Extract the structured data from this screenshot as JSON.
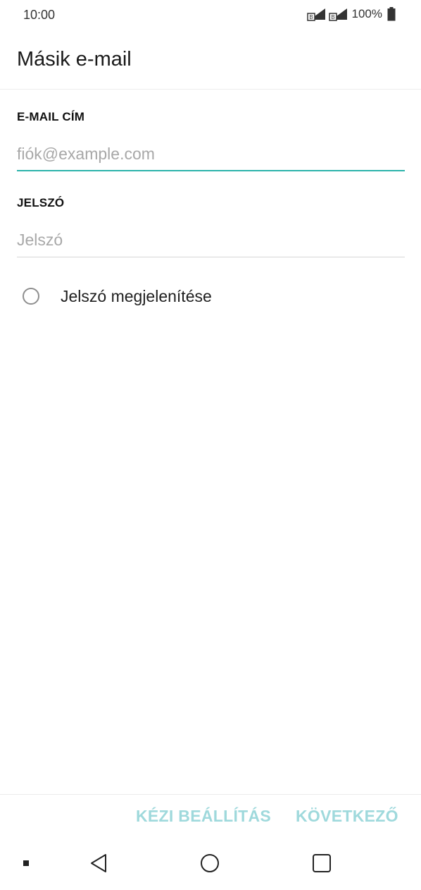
{
  "status_bar": {
    "time": "10:00",
    "battery": "100%",
    "signal_badge": "B"
  },
  "app_bar": {
    "title": "Másik e-mail"
  },
  "form": {
    "email": {
      "label": "E-MAIL CÍM",
      "placeholder": "fiók@example.com",
      "value": "",
      "focused": true
    },
    "password": {
      "label": "JELSZÓ",
      "placeholder": "Jelszó",
      "value": ""
    },
    "show_password": {
      "label": "Jelszó megjelenítése",
      "checked": false
    }
  },
  "actions": {
    "manual_setup": "KÉZI BEÁLLÍTÁS",
    "next": "KÖVETKEZŐ"
  },
  "navigation": {
    "items": [
      "recents-dot-icon",
      "back-icon",
      "home-icon",
      "overview-icon"
    ]
  },
  "colors": {
    "accent": "#2bb3ab",
    "disabled_action": "#9fd9dc",
    "underline_default": "#d6d6d6",
    "nav_icon": "#222222"
  }
}
